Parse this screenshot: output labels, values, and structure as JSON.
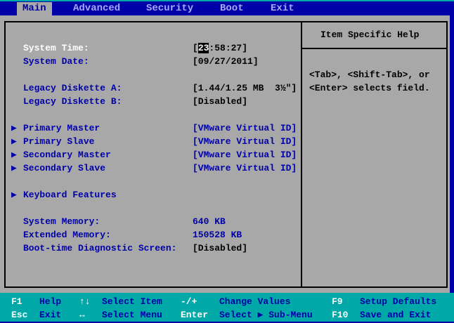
{
  "menu": {
    "tabs": [
      "Main",
      "Advanced",
      "Security",
      "Boot",
      "Exit"
    ],
    "active": "Main"
  },
  "main": {
    "system_time": {
      "label": "System Time:",
      "value_prefix": "[",
      "hour": "23",
      "value_rest": ":58:27]"
    },
    "system_date": {
      "label": "System Date:",
      "value": "[09/27/2011]"
    },
    "diskette_a": {
      "label": "Legacy Diskette A:",
      "value": "[1.44/1.25 MB  3½\"]"
    },
    "diskette_b": {
      "label": "Legacy Diskette B:",
      "value": "[Disabled]"
    },
    "submenus": [
      {
        "label": "Primary Master",
        "value": "[VMware Virtual ID]"
      },
      {
        "label": "Primary Slave",
        "value": "[VMware Virtual ID]"
      },
      {
        "label": "Secondary Master",
        "value": "[VMware Virtual ID]"
      },
      {
        "label": "Secondary Slave",
        "value": "[VMware Virtual ID]"
      }
    ],
    "keyboard": {
      "label": "Keyboard Features"
    },
    "system_memory": {
      "label": "System Memory:",
      "value": "640 KB"
    },
    "extended_memory": {
      "label": "Extended Memory:",
      "value": "150528 KB"
    },
    "boot_diag": {
      "label": "Boot-time Diagnostic Screen:",
      "value": "[Disabled]"
    },
    "arrow": "▶"
  },
  "help": {
    "title": "Item Specific Help",
    "line1": "<Tab>, <Shift-Tab>, or",
    "line2": "<Enter> selects field."
  },
  "footer": {
    "row1": [
      {
        "key": "F1",
        "desc": "Help"
      },
      {
        "key": "↑↓",
        "desc": "Select Item"
      },
      {
        "key": "-/+",
        "desc": "Change Values"
      },
      {
        "key": "F9",
        "desc": "Setup Defaults"
      }
    ],
    "row2": [
      {
        "key": "Esc",
        "desc": "Exit"
      },
      {
        "key": "↔",
        "desc": "Select Menu"
      },
      {
        "key": "Enter",
        "desc": "Select ▶ Sub-Menu"
      },
      {
        "key": "F10",
        "desc": "Save and Exit"
      }
    ]
  }
}
